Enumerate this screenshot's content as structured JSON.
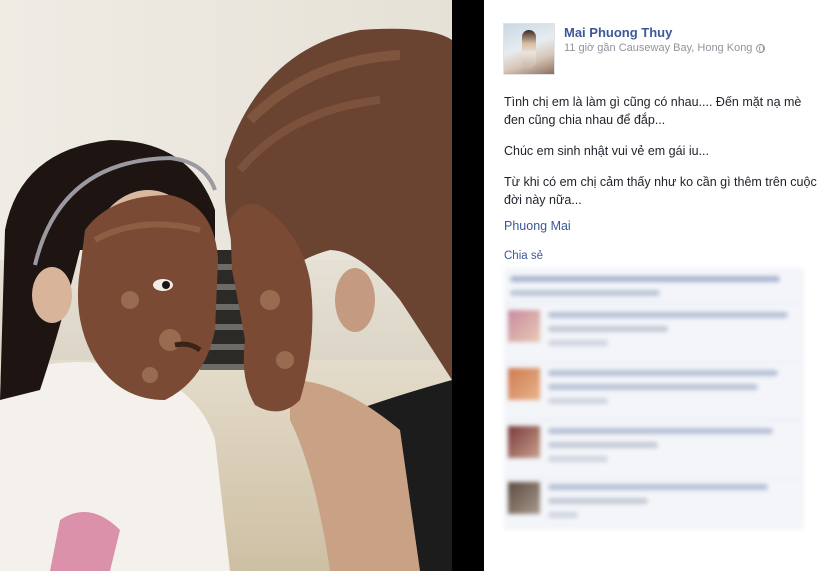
{
  "post": {
    "author": "Mai Phuong Thuy",
    "meta": "11 giờ gần Causeway Bay, Hong Kong",
    "paragraphs": [
      "Tình chị em là làm gì cũng có nhau.... Đến mặt nạ mè đen cũng chia nhau để đắp...",
      "Chúc em sinh nhật vui vẻ em gái iu...",
      "Từ khi có em chị cảm thấy như ko cần gì thêm trên cuộc đời này nữa..."
    ],
    "tag": "Phuong Mai",
    "share_label": "Chia sẻ"
  },
  "colors": {
    "link": "#3b5998",
    "meta": "#90949c",
    "text": "#1d2129",
    "comment_bg": "#f3f5f9"
  },
  "icons": [
    "globe-icon"
  ]
}
